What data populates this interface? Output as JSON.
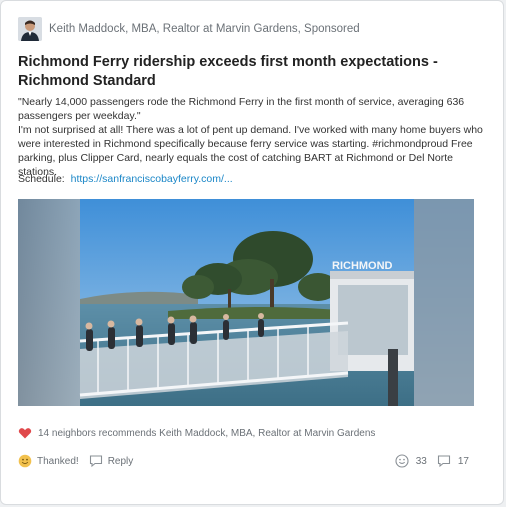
{
  "post": {
    "author_line": "Keith Maddock, MBA, Realtor at Marvin Gardens, Sponsored",
    "title": "Richmond Ferry ridership exceeds first month expectations - Richmond Standard",
    "quote": "\"Nearly 14,000 passengers rode the Richmond Ferry in the first month of service, averaging 636 passengers per weekday.\"",
    "comment": "I'm not surprised at all! There was a lot of pent up demand. I've worked with many home buyers who were interested in Richmond specifically because ferry service was starting. #richmondproud Free parking, plus Clipper Card, nearly equals the cost of catching BART at Richmond or Del Norte stations.",
    "schedule_label": "Schedule:",
    "schedule_link": "https://sanfranciscobayferry.com/...",
    "photo_sign": "RICHMOND"
  },
  "footer": {
    "recommend_text": "14 neighbors recommends Keith Maddock, MBA, Realtor at Marvin Gardens",
    "thanked_label": "Thanked!",
    "reply_label": "Reply",
    "thanks_count": "33",
    "reply_count": "17"
  },
  "colors": {
    "link": "#1a86c7",
    "heart": "#e0484b",
    "smile": "#f2c14e"
  }
}
